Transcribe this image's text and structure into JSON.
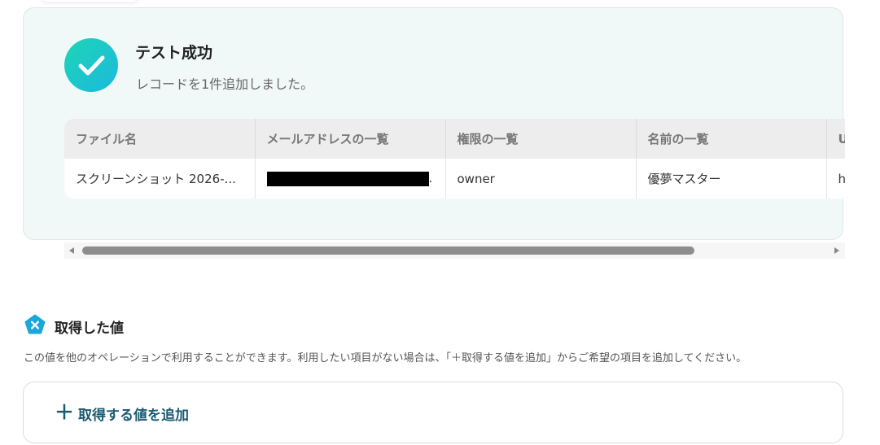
{
  "test_result": {
    "title": "テスト成功",
    "message": "レコードを1件追加しました。"
  },
  "table": {
    "headers": [
      "ファイル名",
      "メールアドレスの一覧",
      "権限の一覧",
      "名前の一覧",
      "U"
    ],
    "rows": [
      [
        "スクリーンショット 2026-...",
        ".",
        "owner",
        "優夢マスター",
        "ht"
      ]
    ]
  },
  "acquired": {
    "title": "取得した値",
    "description": "この値を他のオペレーションで利用することができます。利用したい項目がない場合は、「＋取得する値を追加」からご希望の項目を追加してください。",
    "add_label": "取得する値を追加",
    "add_icon": "＋"
  },
  "colors": {
    "success_gradient_start": "#1ed5b5",
    "success_gradient_end": "#1bb9dd",
    "accent": "#1b5a73",
    "brand_icon": "#1aa7d9"
  }
}
